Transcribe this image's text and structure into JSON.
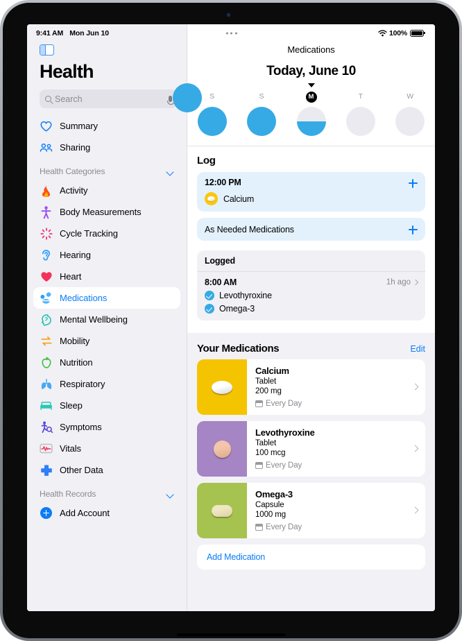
{
  "status_bar": {
    "time": "9:41 AM",
    "date": "Mon Jun 10",
    "battery_percent": "100%",
    "wifi_icon": "wifi-icon",
    "battery_icon": "battery-icon",
    "more_icon": "more-options-icon"
  },
  "sidebar": {
    "toggle_icon": "sidebar-toggle-icon",
    "app_title": "Health",
    "search": {
      "placeholder": "Search",
      "search_icon": "search-icon",
      "mic_icon": "microphone-icon"
    },
    "top_items": [
      {
        "label": "Summary",
        "icon": "heart-outline-icon",
        "color": "#0a7cf6"
      },
      {
        "label": "Sharing",
        "icon": "people-icon",
        "color": "#0a7cf6"
      }
    ],
    "categories_header": {
      "label": "Health Categories",
      "chevron": "chevron-down-icon"
    },
    "categories": [
      {
        "label": "Activity",
        "icon": "flame-icon",
        "color": "#ff4f12"
      },
      {
        "label": "Body Measurements",
        "icon": "body-icon",
        "color": "#9b4df0"
      },
      {
        "label": "Cycle Tracking",
        "icon": "cycle-icon",
        "color": "#f2316a"
      },
      {
        "label": "Hearing",
        "icon": "ear-icon",
        "color": "#2f9dfc"
      },
      {
        "label": "Medications",
        "icon": "pills-icon",
        "color": "#2f9dfc",
        "selected": true
      },
      {
        "label": "Mental Wellbeing",
        "icon": "brain-head-icon",
        "color": "#27c3b4"
      },
      {
        "label": "Mobility",
        "icon": "arrows-icon",
        "color": "#f5a623"
      },
      {
        "label": "Nutrition",
        "icon": "apple-icon",
        "color": "#3ec13e"
      },
      {
        "label": "Respiratory",
        "icon": "lungs-icon",
        "color": "#46a9f5"
      },
      {
        "label": "Sleep",
        "icon": "bed-icon",
        "color": "#2bc7b5"
      },
      {
        "label": "Symptoms",
        "icon": "symptoms-icon",
        "color": "#5b4bd6"
      },
      {
        "label": "Vitals",
        "icon": "vitals-icon",
        "color": "#f43f5e"
      },
      {
        "label": "Other Data",
        "icon": "plus-cross-icon",
        "color": "#2f7ff5"
      }
    ],
    "records_header": {
      "label": "Health Records",
      "chevron": "chevron-down-icon"
    },
    "add_account": {
      "label": "Add Account",
      "icon": "plus-circle-icon"
    }
  },
  "main": {
    "nav_title": "Medications",
    "date_title": "Today, June 10",
    "caret_icon": "caret-down-icon",
    "week": {
      "days": [
        {
          "letter": "S",
          "today": false,
          "fill_percent": 100
        },
        {
          "letter": "S",
          "today": false,
          "fill_percent": 100
        },
        {
          "letter": "M",
          "today": true,
          "fill_percent": 50
        },
        {
          "letter": "T",
          "today": false,
          "fill_percent": 0
        },
        {
          "letter": "W",
          "today": false,
          "fill_percent": 0
        }
      ],
      "edge_partial_left": true
    },
    "log": {
      "title": "Log",
      "scheduled": {
        "time": "12:00 PM",
        "add_icon": "plus-icon",
        "medication": "Calcium",
        "pill_icon": "tablet-pill-icon",
        "pill_color": "#fcc609"
      },
      "as_needed": {
        "label": "As Needed Medications",
        "add_icon": "plus-icon"
      },
      "logged": {
        "header": "Logged",
        "time": "8:00 AM",
        "ago": "1h ago",
        "chevron": "chevron-right-icon",
        "items": [
          {
            "name": "Levothyroxine",
            "icon": "checkmark-circle-icon"
          },
          {
            "name": "Omega-3",
            "icon": "checkmark-circle-icon"
          }
        ]
      }
    },
    "your_medications": {
      "title": "Your Medications",
      "edit_label": "Edit",
      "items": [
        {
          "name": "Calcium",
          "form": "Tablet",
          "dose": "200 mg",
          "frequency": "Every Day",
          "calendar_icon": "calendar-icon",
          "chevron": "chevron-right-icon",
          "swatch_color": "#f5c400",
          "shape": "oval"
        },
        {
          "name": "Levothyroxine",
          "form": "Tablet",
          "dose": "100 mcg",
          "frequency": "Every Day",
          "calendar_icon": "calendar-icon",
          "chevron": "chevron-right-icon",
          "swatch_color": "#a585c4",
          "shape": "round"
        },
        {
          "name": "Omega-3",
          "form": "Capsule",
          "dose": "1000 mg",
          "frequency": "Every Day",
          "calendar_icon": "calendar-icon",
          "chevron": "chevron-right-icon",
          "swatch_color": "#a6c34f",
          "shape": "capsule"
        }
      ],
      "add_medication_label": "Add Medication"
    }
  },
  "theme": {
    "accent_blue": "#0a7cf6",
    "ring_blue": "#36aae4",
    "card_blue_bg": "#e3f1fc",
    "panel_gray": "#f2f1f6"
  }
}
